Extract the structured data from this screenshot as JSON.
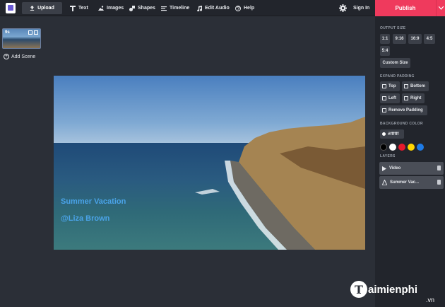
{
  "toolbar": {
    "upload_label": "Upload",
    "items": [
      {
        "label": "Text",
        "icon": "text-icon"
      },
      {
        "label": "Images",
        "icon": "images-icon"
      },
      {
        "label": "Shapes",
        "icon": "shapes-icon"
      },
      {
        "label": "Timeline",
        "icon": "timeline-icon"
      },
      {
        "label": "Edit Audio",
        "icon": "audio-icon"
      },
      {
        "label": "Help",
        "icon": "help-icon"
      }
    ],
    "signin_label": "Sign In",
    "publish_label": "Publish",
    "accent": "#ef3a5d"
  },
  "scenes": {
    "items": [
      {
        "duration": "9s"
      }
    ],
    "add_label": "Add Scene"
  },
  "canvas": {
    "captions": [
      "Summer Vacation",
      "@Liza Brown"
    ],
    "caption_color": "#4aa3e8"
  },
  "panel": {
    "output_size": {
      "title": "OUTPUT SIZE",
      "options": [
        "1:1",
        "9:16",
        "16:9",
        "4:5",
        "5:4"
      ],
      "custom_label": "Custom Size"
    },
    "expand_padding": {
      "title": "EXPAND PADDING",
      "options": [
        "Top",
        "Bottom",
        "Left",
        "Right",
        "Remove Padding"
      ]
    },
    "background_color": {
      "title": "BACKGROUND COLOR",
      "value": "#ffffff",
      "swatches": [
        "#000000",
        "#ffffff",
        "#e8192c",
        "#ffd600",
        "#1e7be6"
      ]
    },
    "layers": {
      "title": "LAYERS",
      "items": [
        "Video",
        "Summer Vac..."
      ]
    }
  },
  "watermark": {
    "logo_letter": "T",
    "brand": "aimienphi",
    "domain": ".vn"
  }
}
